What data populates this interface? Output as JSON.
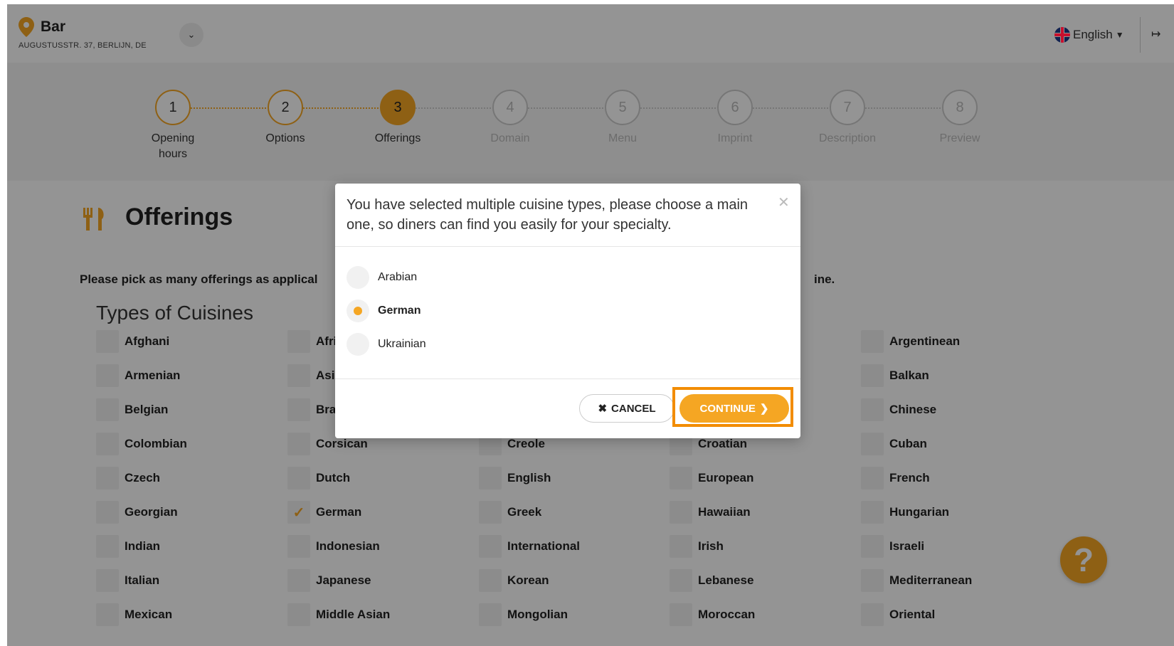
{
  "header": {
    "business_name": "Bar",
    "business_address": "AUGUSTUSSTR. 37, BERLIJN, DE",
    "language": "English"
  },
  "stepper": {
    "steps": [
      {
        "num": "1",
        "label": "Opening hours",
        "state": "done"
      },
      {
        "num": "2",
        "label": "Options",
        "state": "done"
      },
      {
        "num": "3",
        "label": "Offerings",
        "state": "active"
      },
      {
        "num": "4",
        "label": "Domain",
        "state": "todo"
      },
      {
        "num": "5",
        "label": "Menu",
        "state": "todo"
      },
      {
        "num": "6",
        "label": "Imprint",
        "state": "todo"
      },
      {
        "num": "7",
        "label": "Description",
        "state": "todo"
      },
      {
        "num": "8",
        "label": "Preview",
        "state": "todo"
      }
    ]
  },
  "page": {
    "title": "Offerings",
    "intro_left": "Please pick as many offerings as applical",
    "intro_right": "ine.",
    "cuisine_section_title": "Types of Cuisines"
  },
  "cuisines": [
    {
      "label": "Afghani",
      "checked": false
    },
    {
      "label": "Afri",
      "checked": false
    },
    {
      "label": "",
      "checked": false
    },
    {
      "label": "",
      "checked": false
    },
    {
      "label": "Argentinean",
      "checked": false
    },
    {
      "label": "Armenian",
      "checked": false
    },
    {
      "label": "Asi",
      "checked": false
    },
    {
      "label": "",
      "checked": false
    },
    {
      "label": "",
      "checked": false
    },
    {
      "label": "Balkan",
      "checked": false
    },
    {
      "label": "Belgian",
      "checked": false
    },
    {
      "label": "Bra",
      "checked": false
    },
    {
      "label": "",
      "checked": false
    },
    {
      "label": "",
      "checked": false
    },
    {
      "label": "Chinese",
      "checked": false
    },
    {
      "label": "Colombian",
      "checked": false
    },
    {
      "label": "Corsican",
      "checked": false
    },
    {
      "label": "Creole",
      "checked": false
    },
    {
      "label": "Croatian",
      "checked": false
    },
    {
      "label": "Cuban",
      "checked": false
    },
    {
      "label": "Czech",
      "checked": false
    },
    {
      "label": "Dutch",
      "checked": false
    },
    {
      "label": "English",
      "checked": false
    },
    {
      "label": "European",
      "checked": false
    },
    {
      "label": "French",
      "checked": false
    },
    {
      "label": "Georgian",
      "checked": false
    },
    {
      "label": "German",
      "checked": true
    },
    {
      "label": "Greek",
      "checked": false
    },
    {
      "label": "Hawaiian",
      "checked": false
    },
    {
      "label": "Hungarian",
      "checked": false
    },
    {
      "label": "Indian",
      "checked": false
    },
    {
      "label": "Indonesian",
      "checked": false
    },
    {
      "label": "International",
      "checked": false
    },
    {
      "label": "Irish",
      "checked": false
    },
    {
      "label": "Israeli",
      "checked": false
    },
    {
      "label": "Italian",
      "checked": false
    },
    {
      "label": "Japanese",
      "checked": false
    },
    {
      "label": "Korean",
      "checked": false
    },
    {
      "label": "Lebanese",
      "checked": false
    },
    {
      "label": "Mediterranean",
      "checked": false
    },
    {
      "label": "Mexican",
      "checked": false
    },
    {
      "label": "Middle Asian",
      "checked": false
    },
    {
      "label": "Mongolian",
      "checked": false
    },
    {
      "label": "Moroccan",
      "checked": false
    },
    {
      "label": "Oriental",
      "checked": false
    }
  ],
  "modal": {
    "message": "You have selected multiple cuisine types, please choose a main one, so diners can find you easily for your specialty.",
    "options": [
      {
        "label": "Arabian",
        "selected": false
      },
      {
        "label": "German",
        "selected": true
      },
      {
        "label": "Ukrainian",
        "selected": false
      }
    ],
    "cancel_label": "CANCEL",
    "continue_label": "CONTINUE"
  },
  "colors": {
    "accent": "#f5a623",
    "highlight": "#f28c00",
    "overlay": "rgba(0,0,0,0.42)"
  },
  "icons": {
    "location": "location-pin-icon",
    "dropdown": "chevron-down-icon",
    "flag": "uk-flag-icon",
    "logout": "logout-icon",
    "offerings": "fork-knife-icon",
    "help": "question-mark-icon",
    "close": "close-icon",
    "cancel": "x-icon",
    "continue": "chevron-right-icon"
  }
}
